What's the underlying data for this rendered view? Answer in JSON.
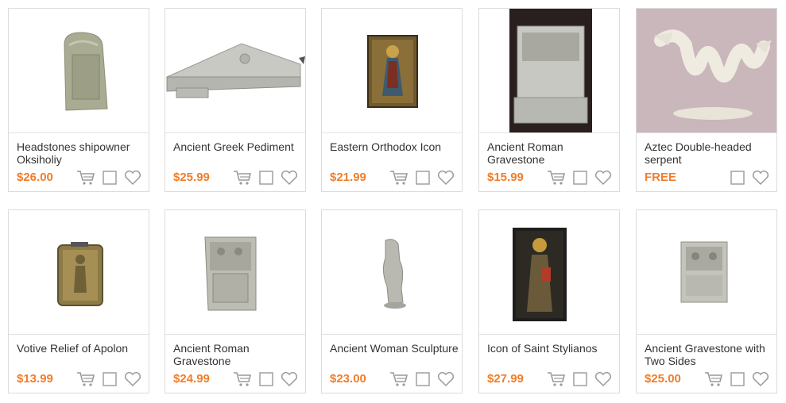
{
  "accent_color": "#f07d2c",
  "products": [
    {
      "title": "Headstones shipowner Oksiholiy",
      "price": "$26.00",
      "icons": [
        "cart-icon",
        "checkbox",
        "heart-icon"
      ]
    },
    {
      "title": "Ancient Greek Pediment",
      "price": "$25.99",
      "icons": [
        "cart-icon",
        "checkbox",
        "heart-icon"
      ]
    },
    {
      "title": "Eastern Orthodox Icon",
      "price": "$21.99",
      "icons": [
        "cart-icon",
        "checkbox",
        "heart-icon"
      ]
    },
    {
      "title": "Ancient Roman Gravestone",
      "price": "$15.99",
      "icons": [
        "cart-icon",
        "checkbox",
        "heart-icon"
      ]
    },
    {
      "title": "Aztec Double-headed serpent",
      "price": "FREE",
      "icons": [
        "checkbox",
        "heart-icon"
      ]
    },
    {
      "title": "Votive Relief of Apolon",
      "price": "$13.99",
      "icons": [
        "cart-icon",
        "checkbox",
        "heart-icon"
      ]
    },
    {
      "title": "Ancient Roman Gravestone",
      "price": "$24.99",
      "icons": [
        "cart-icon",
        "checkbox",
        "heart-icon"
      ]
    },
    {
      "title": "Ancient Woman Sculpture",
      "price": "$23.00",
      "icons": [
        "cart-icon",
        "checkbox",
        "heart-icon"
      ]
    },
    {
      "title": "Icon of Saint Stylianos",
      "price": "$27.99",
      "icons": [
        "cart-icon",
        "checkbox",
        "heart-icon"
      ]
    },
    {
      "title": "Ancient Gravestone with Two Sides",
      "price": "$25.00",
      "icons": [
        "cart-icon",
        "checkbox",
        "heart-icon"
      ]
    }
  ]
}
